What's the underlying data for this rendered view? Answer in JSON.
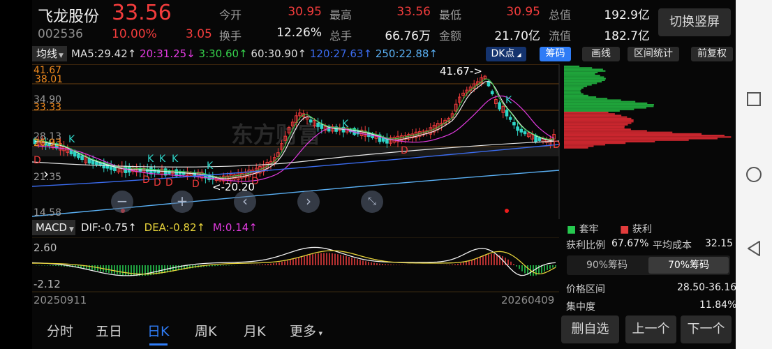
{
  "stock": {
    "name": "飞龙股份",
    "price": "33.56",
    "code": "002536",
    "change_pct": "10.00%",
    "change_amt": "3.05"
  },
  "quote": [
    {
      "label": "今开",
      "value": "30.95",
      "color": "red"
    },
    {
      "label": "最高",
      "value": "33.56",
      "color": "red"
    },
    {
      "label": "最低",
      "value": "30.95",
      "color": "red"
    },
    {
      "label": "总值",
      "value": "192.9亿",
      "color": "white"
    },
    {
      "label": "换手",
      "value": "12.26%",
      "color": "white"
    },
    {
      "label": "总手",
      "value": "66.76万",
      "color": "white"
    },
    {
      "label": "金额",
      "value": "21.70亿",
      "color": "white"
    },
    {
      "label": "流值",
      "value": "182.7亿",
      "color": "white"
    }
  ],
  "switch_label": "切换竖屏",
  "ma_bar": {
    "selector": "均线",
    "items": [
      {
        "text": "MA5:29.42↑",
        "color": "#dddddd"
      },
      {
        "text": "20:31.25↓",
        "color": "#e23be0"
      },
      {
        "text": "3:30.60↑",
        "color": "#35d04b"
      },
      {
        "text": "60:30.90↑",
        "color": "#dddddd"
      },
      {
        "text": "120:27.63↑",
        "color": "#3b6cf0"
      },
      {
        "text": "250:22.88↑",
        "color": "#5ab0f4"
      }
    ]
  },
  "toolbar": {
    "dk": "DK点",
    "chips": "筹码",
    "draw": "画线",
    "range": "区间统计",
    "adjust": "前复权"
  },
  "price_axis": {
    "p1": "41.67",
    "p2": "38.01",
    "p3": "34.90",
    "p4": "33.33",
    "p5": "28.13",
    "p6": "26.93",
    "p7": "21.35",
    "p8": "14.58"
  },
  "annotations": {
    "high": "41.67->",
    "low": "<-20.20",
    "k": "K",
    "d": "D"
  },
  "macd": {
    "label": "MACD",
    "dif": "DIF:-0.75↑",
    "dea": "DEA:-0.82↑",
    "m": "M:0.14↑",
    "top": "2.60",
    "bottom": "-2.12"
  },
  "dates": {
    "start": "20250911",
    "end": "20260409"
  },
  "chips": {
    "legend_trap": "套牢",
    "legend_profit": "获利",
    "profit_ratio_label": "获利比例",
    "profit_ratio": "67.67%",
    "avg_cost_label": "平均成本",
    "avg_cost": "32.15",
    "tab90": "90%筹码",
    "tab70": "70%筹码",
    "price_range_label": "价格区间",
    "price_range": "28.50-36.16",
    "concentration_label": "集中度",
    "concentration": "11.84%"
  },
  "bottom_tabs": [
    {
      "label": "分时",
      "active": false
    },
    {
      "label": "五日",
      "active": false
    },
    {
      "label": "日K",
      "active": true
    },
    {
      "label": "周K",
      "active": false
    },
    {
      "label": "月K",
      "active": false
    },
    {
      "label": "更多",
      "active": false
    }
  ],
  "actions": {
    "remove": "删自选",
    "prev": "上一个",
    "next": "下一个"
  },
  "colors": {
    "up": "#f23c3c",
    "down": "#2fd5c8",
    "accent": "#2f7cf6"
  }
}
